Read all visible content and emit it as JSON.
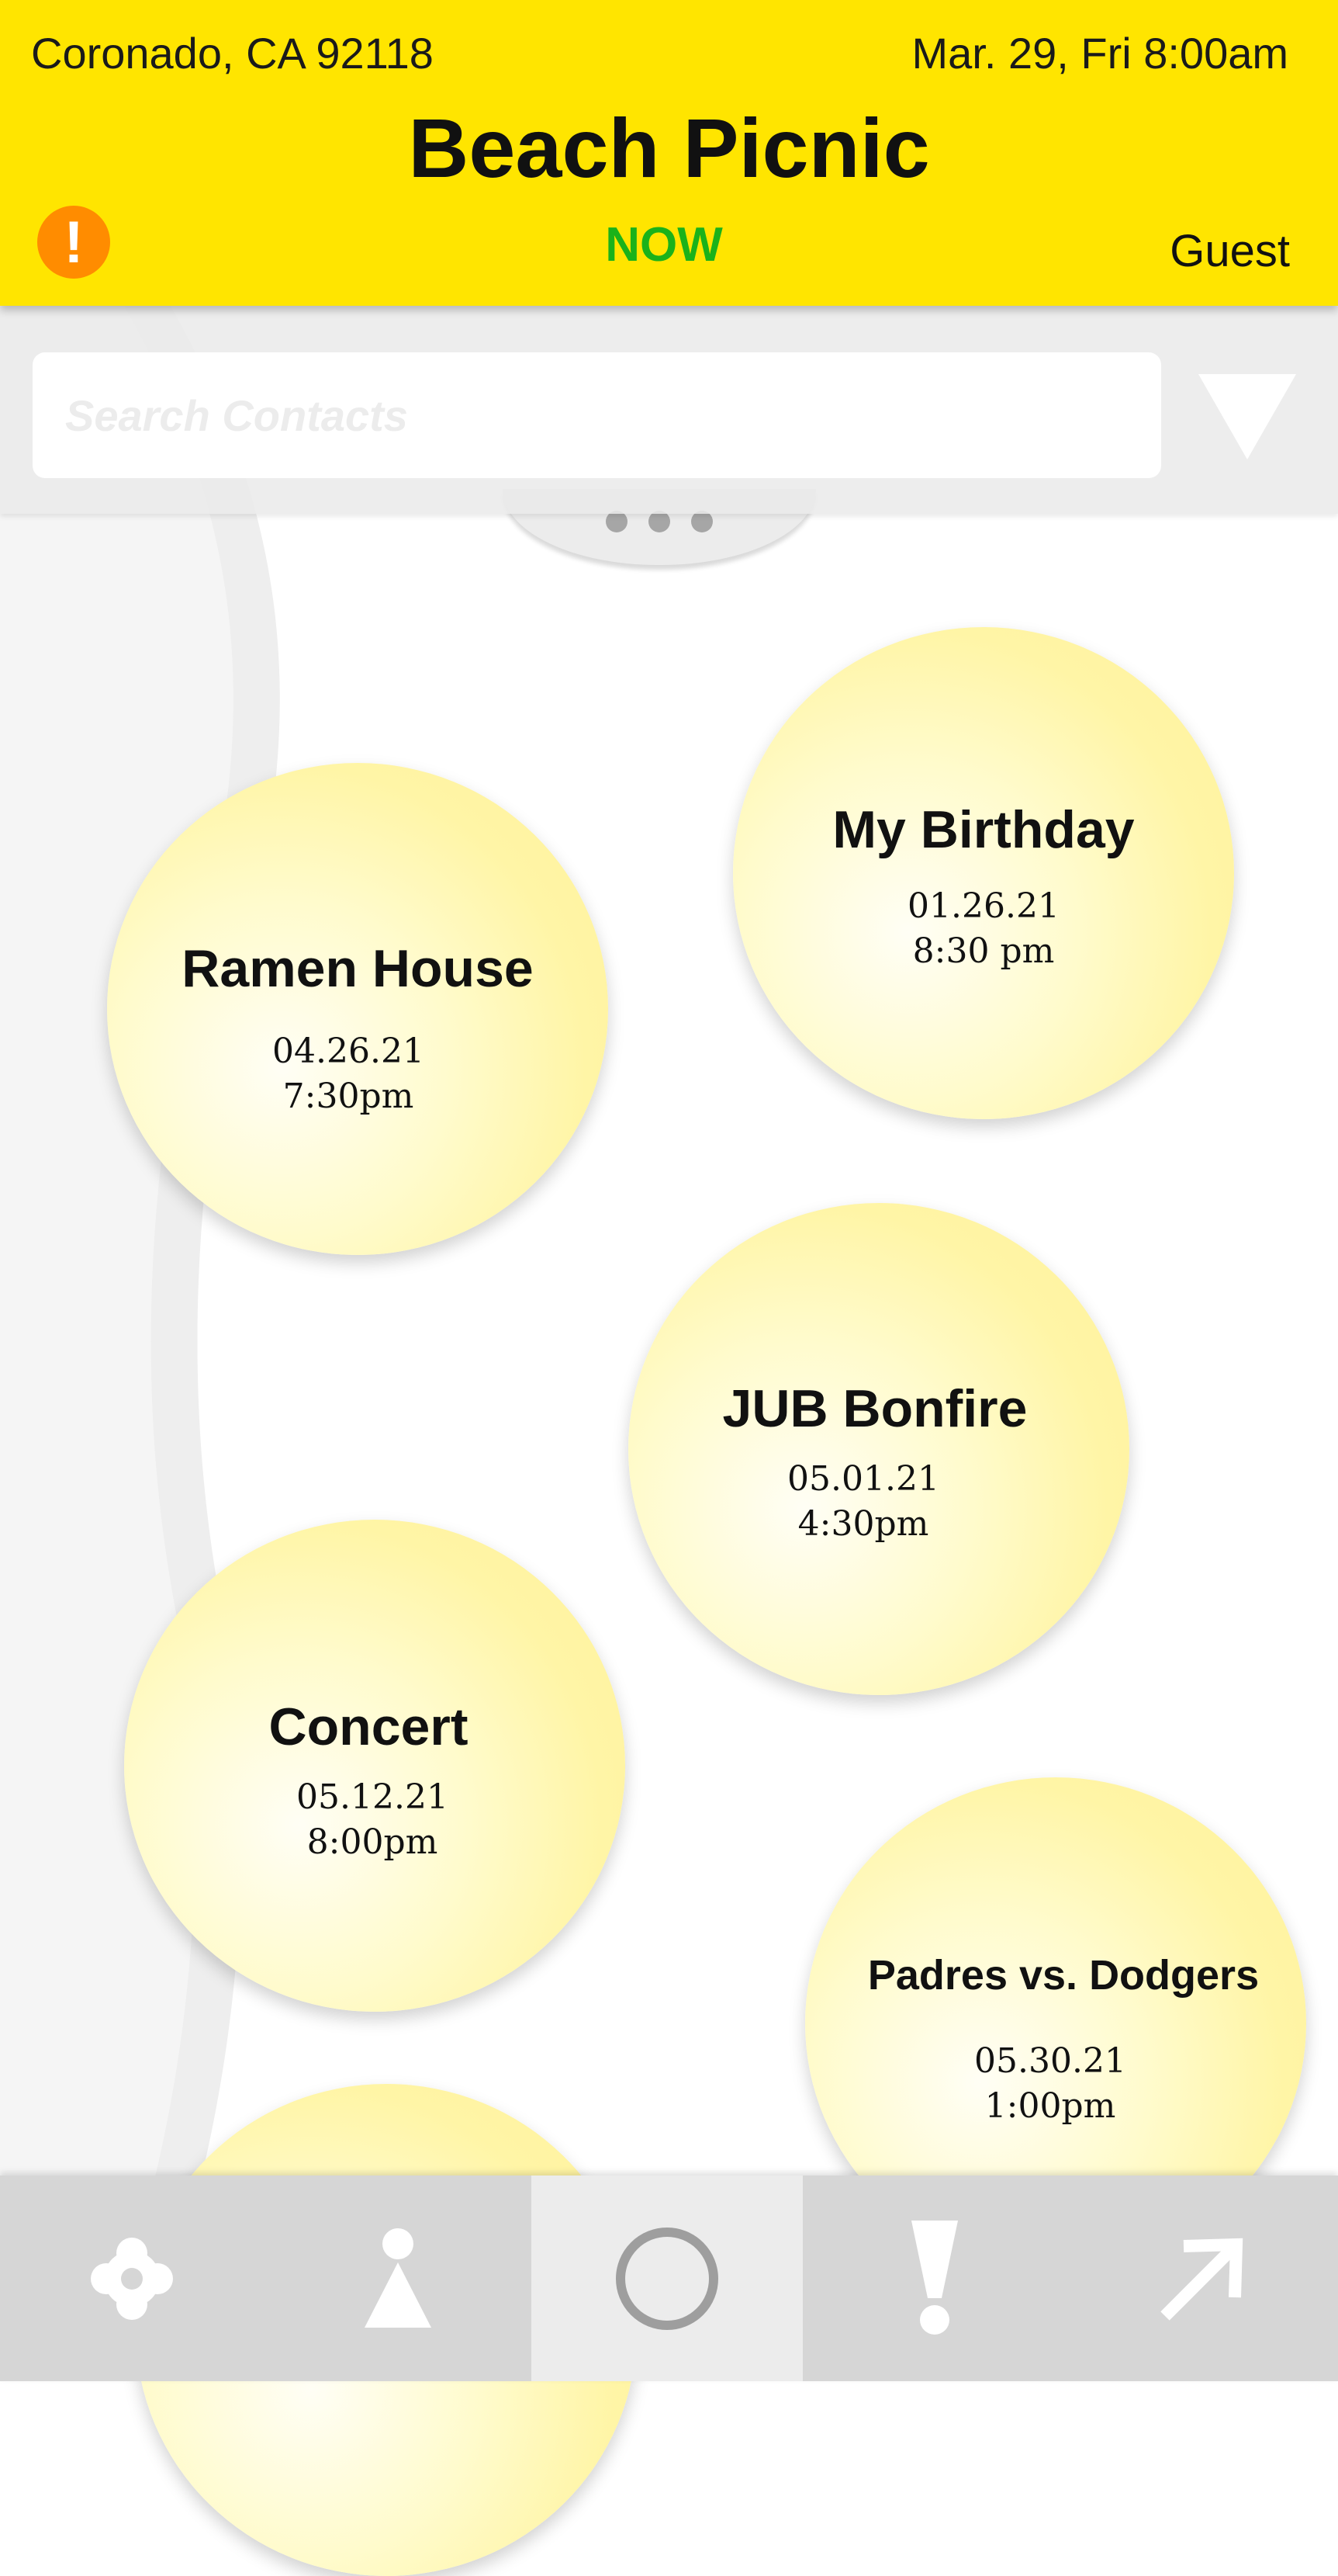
{
  "header": {
    "location": "Coronado, CA 92118",
    "datetime": "Mar. 29, Fri 8:00am",
    "title": "Beach Picnic",
    "alert_symbol": "!",
    "status": "NOW",
    "user": "Guest"
  },
  "search": {
    "placeholder": "Search Contacts",
    "value": ""
  },
  "events": [
    {
      "name": "My Birthday",
      "date": "01.26.21",
      "time": "8:30 pm"
    },
    {
      "name": "Ramen House",
      "date": "04.26.21",
      "time": "7:30pm"
    },
    {
      "name": "JUB Bonfire",
      "date": "05.01.21",
      "time": "4:30pm"
    },
    {
      "name": "Concert",
      "date": "05.12.21",
      "time": "8:00pm"
    },
    {
      "name": "Padres vs. Dodgers",
      "date": "05.30.21",
      "time": "1:00pm"
    }
  ],
  "nav": {
    "items": [
      {
        "icon": "settings-icon"
      },
      {
        "icon": "person-icon"
      },
      {
        "icon": "circle-icon",
        "active": true
      },
      {
        "icon": "alert-icon"
      },
      {
        "icon": "arrow-up-right-icon"
      }
    ]
  },
  "colors": {
    "header_bg": "#ffe500",
    "alert": "#ff8c00",
    "now": "#1ab21a",
    "bubble": "#fff19a",
    "nav_bg": "#d6d6d6"
  }
}
